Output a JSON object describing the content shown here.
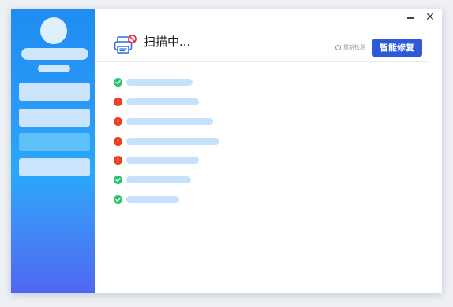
{
  "header": {
    "title": "扫描中...",
    "rescan_label": "重新检测",
    "repair_label": "智能修复"
  },
  "window_controls": {
    "minimize_icon": "minimize-icon",
    "close_icon": "close-icon",
    "close_glyph": "✕"
  },
  "sidebar": {
    "items": [
      {
        "id": "nav-1",
        "active": false
      },
      {
        "id": "nav-2",
        "active": false
      },
      {
        "id": "nav-3",
        "active": true
      },
      {
        "id": "nav-4",
        "active": false
      }
    ]
  },
  "scan_items": [
    {
      "status": "ok"
    },
    {
      "status": "error"
    },
    {
      "status": "error"
    },
    {
      "status": "error"
    },
    {
      "status": "error"
    },
    {
      "status": "ok"
    },
    {
      "status": "ok"
    }
  ],
  "colors": {
    "accent": "#2d5bd8",
    "ok": "#27c46a",
    "error": "#ee3a1e",
    "placeholder": "#c6e1fb"
  }
}
